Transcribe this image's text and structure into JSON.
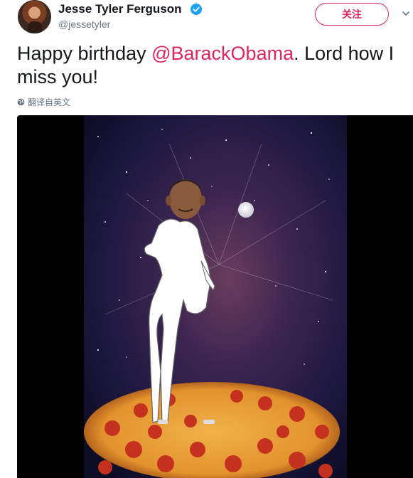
{
  "author": {
    "name": "Jesse Tyler Ferguson",
    "handle": "@jessetyler",
    "verified": true
  },
  "follow_button": {
    "label": "关注"
  },
  "tweet": {
    "text_before": "Happy birthday ",
    "mention": "@BarackObama",
    "text_after": ". Lord how I miss you!"
  },
  "translate": {
    "label": "翻译自英文"
  },
  "colors": {
    "accent": "#e0245e",
    "verified": "#1da1f2",
    "secondary_text": "#657786"
  },
  "icons": [
    "avatar",
    "verified-badge-icon",
    "chevron-down-icon",
    "globe-icon"
  ]
}
